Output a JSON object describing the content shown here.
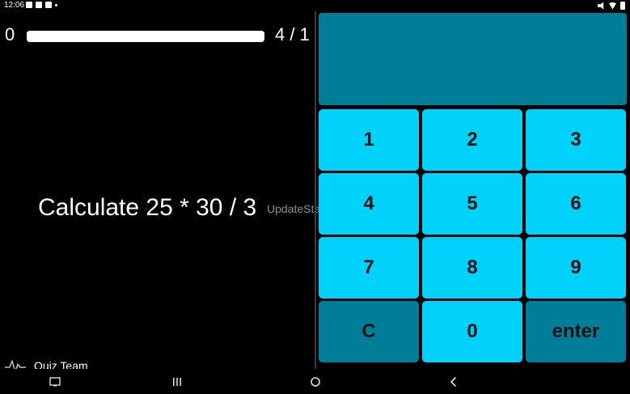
{
  "status_bar": {
    "time": "12:06",
    "left_icons": [
      "gallery-icon",
      "mail-icon",
      "mail-icon",
      "notification-dot-icon"
    ],
    "right_icons": [
      "mute-icon",
      "wifi-icon",
      "battery-icon"
    ]
  },
  "quiz": {
    "score": "0",
    "progress_fraction": 1.0,
    "counter": "4 / 1",
    "question": "Calculate 25 * 30 / 3",
    "watermark": "UpdateStar.com",
    "team_name": "Quiz Team",
    "team_icon": "pulse-icon"
  },
  "display": {
    "value": ""
  },
  "keypad": {
    "keys": [
      {
        "label": "1",
        "style": "light"
      },
      {
        "label": "2",
        "style": "light"
      },
      {
        "label": "3",
        "style": "light"
      },
      {
        "label": "4",
        "style": "light"
      },
      {
        "label": "5",
        "style": "light"
      },
      {
        "label": "6",
        "style": "light"
      },
      {
        "label": "7",
        "style": "light"
      },
      {
        "label": "8",
        "style": "light"
      },
      {
        "label": "9",
        "style": "light"
      },
      {
        "label": "C",
        "style": "dark"
      },
      {
        "label": "0",
        "style": "light"
      },
      {
        "label": "enter",
        "style": "dark"
      }
    ]
  },
  "nav_bar": {
    "buttons": [
      "screenshot-icon",
      "recent-apps-icon",
      "home-icon",
      "back-icon"
    ]
  },
  "colors": {
    "background": "#000000",
    "key_light": "#00d2fb",
    "key_dark": "#007e99",
    "display": "#007e99",
    "text_dark": "#111111",
    "text_light": "#ffffff"
  }
}
